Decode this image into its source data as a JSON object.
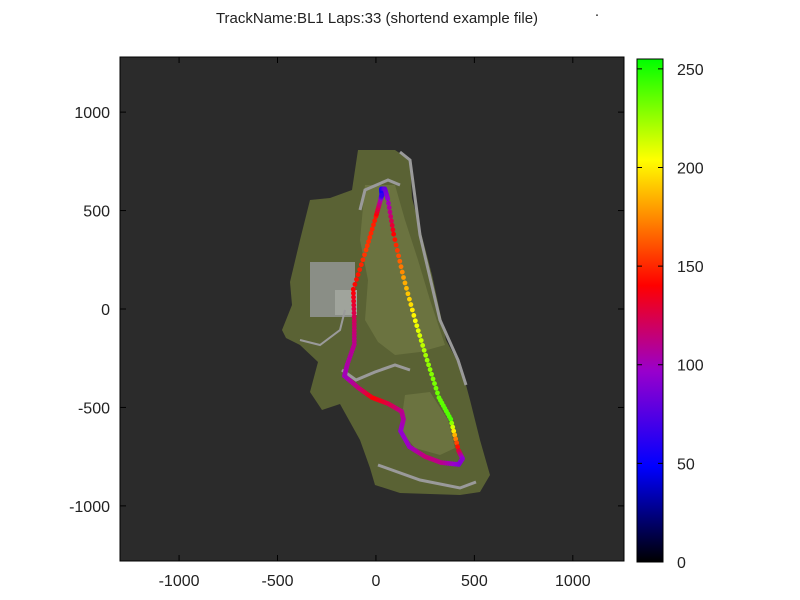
{
  "chart_data": {
    "type": "scatter",
    "title": "TrackName:BL1 Laps:33 (shortend example file)",
    "xlim": [
      -1300,
      1260
    ],
    "ylim": [
      -1280,
      1280
    ],
    "x_ticks": [
      -1000,
      -500,
      0,
      500,
      1000
    ],
    "y_ticks": [
      -1000,
      -500,
      0,
      500,
      1000
    ],
    "colorbar": {
      "range": [
        0,
        255
      ],
      "ticks": [
        0,
        50,
        100,
        150,
        200,
        250
      ],
      "colors": [
        "#000000",
        "#0000ff",
        "#9900cc",
        "#ff0000",
        "#ff9900",
        "#ffff00",
        "#00ff00"
      ]
    },
    "background_color": "#2b2b2b",
    "grid": false,
    "series": [
      {
        "name": "",
        "x": [
          30,
          28,
          45,
          60,
          90,
          140,
          200,
          260,
          320,
          380,
          420,
          440,
          420,
          330,
          250,
          170,
          125,
          140,
          130,
          60,
          -20,
          -90,
          -160,
          -145,
          -110,
          -110,
          -115,
          -50,
          0,
          25
        ],
        "y": [
          580,
          610,
          610,
          560,
          380,
          160,
          -60,
          -260,
          -450,
          -560,
          -720,
          -760,
          -790,
          -780,
          -750,
          -700,
          -620,
          -560,
          -520,
          -480,
          -450,
          -400,
          -340,
          -280,
          -180,
          -60,
          100,
          300,
          470,
          560
        ],
        "value": [
          60,
          55,
          80,
          95,
          140,
          180,
          205,
          225,
          235,
          240,
          130,
          95,
          90,
          110,
          115,
          100,
          95,
          105,
          110,
          125,
          140,
          115,
          100,
          105,
          110,
          120,
          140,
          155,
          145,
          100
        ]
      }
    ]
  }
}
